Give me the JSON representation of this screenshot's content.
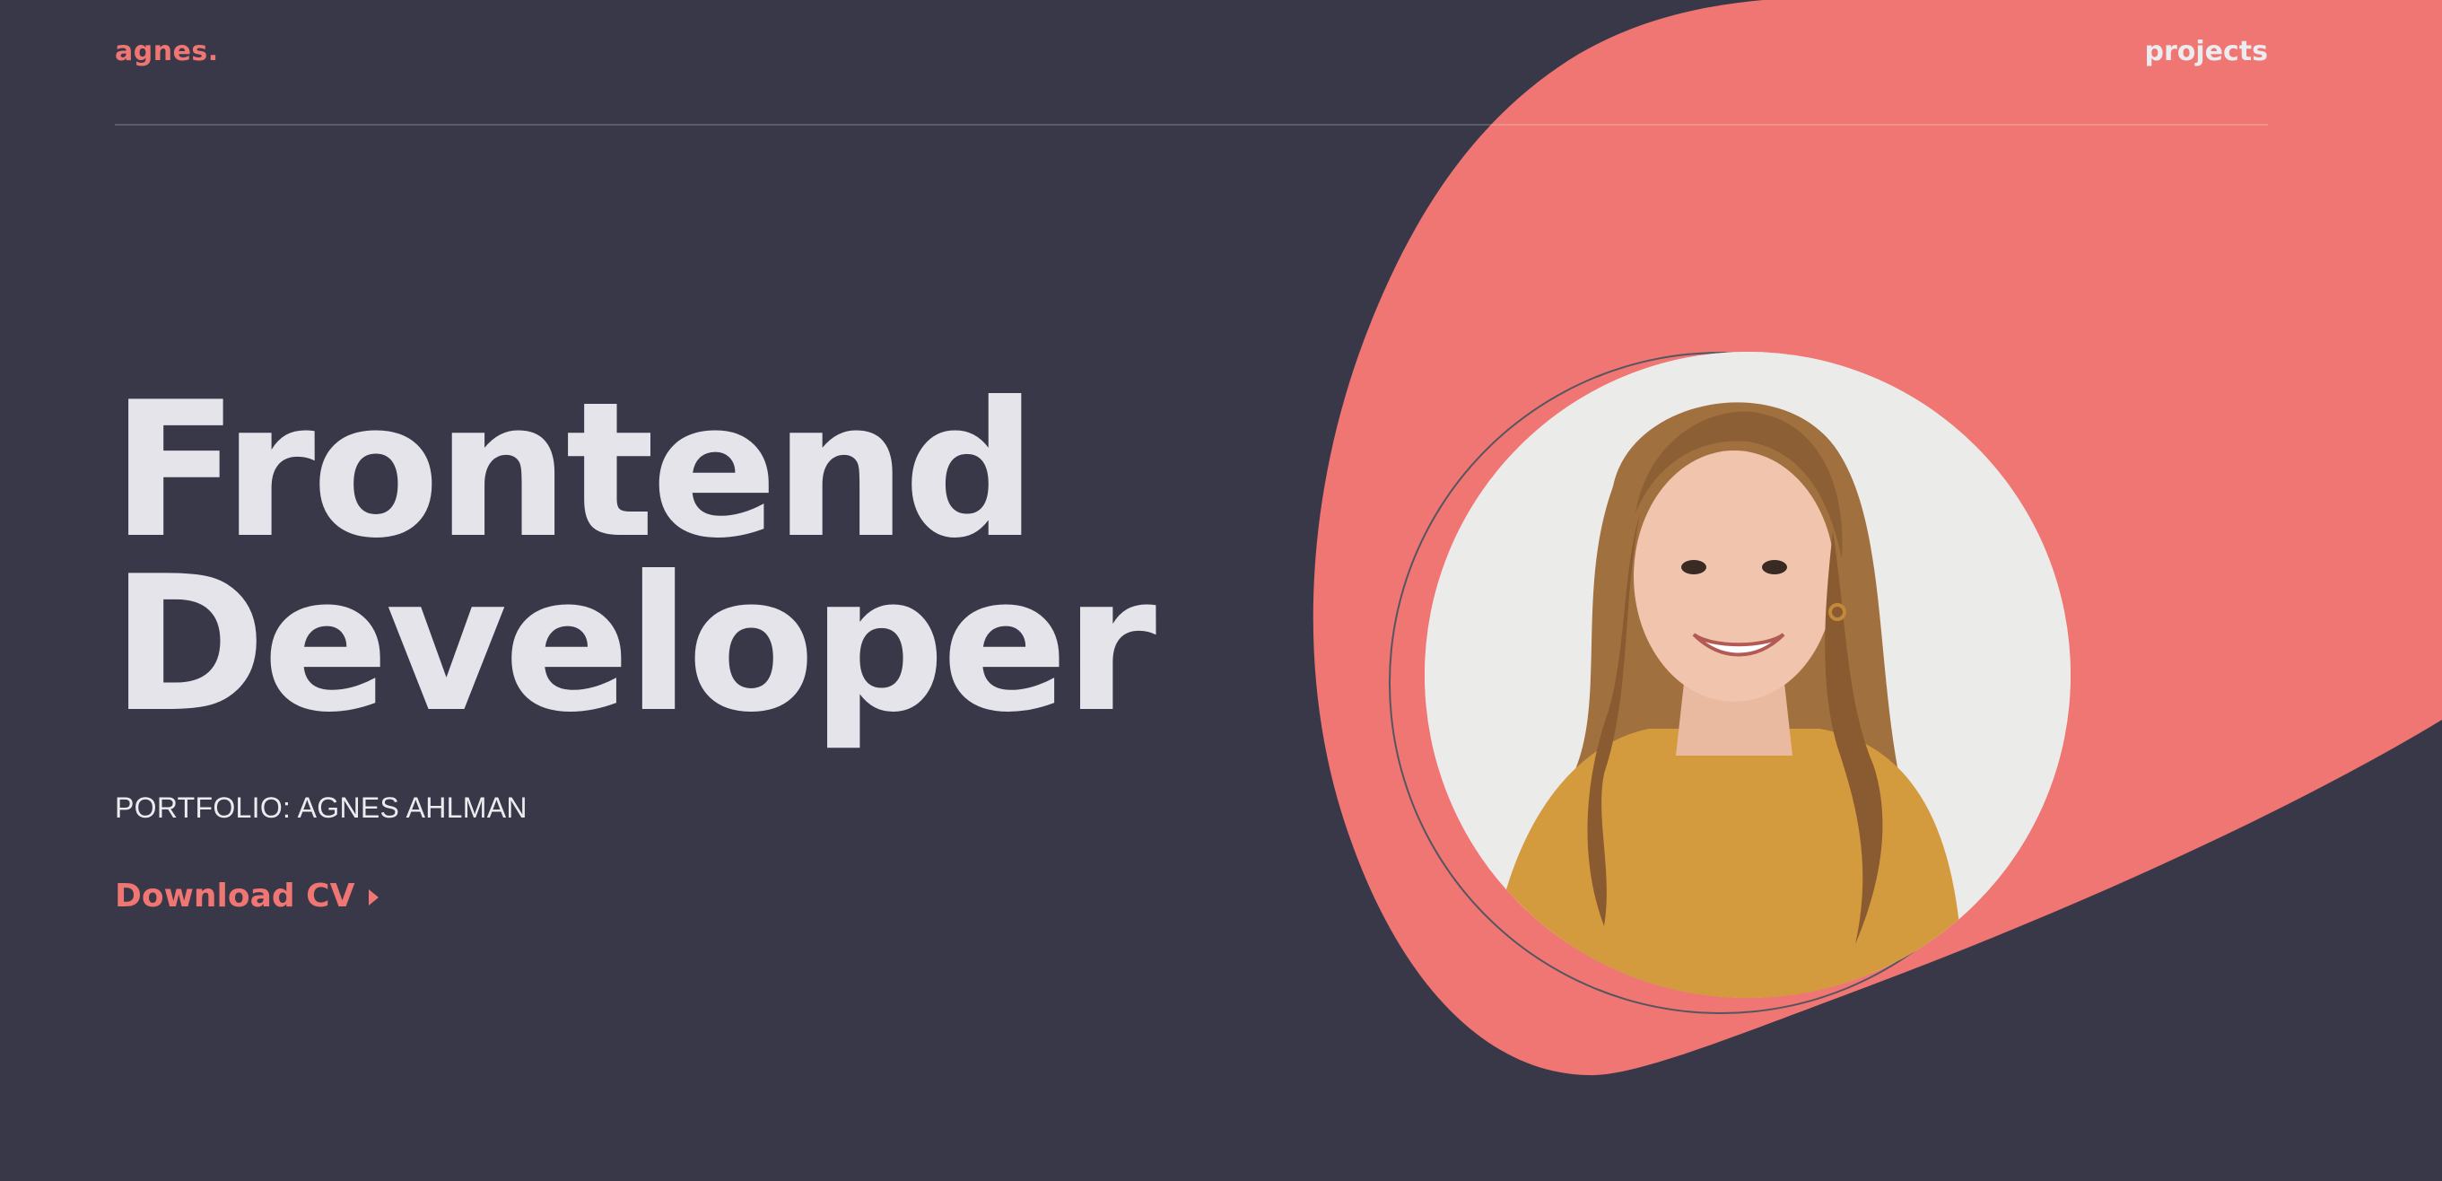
{
  "header": {
    "logo": "agnes.",
    "nav_projects": "projects"
  },
  "hero": {
    "title_line1": "Frontend",
    "title_line2": "Developer",
    "subtitle": "PORTFOLIO: AGNES AHLMAN",
    "cta_label": "Download CV"
  },
  "colors": {
    "background": "#383849",
    "accent": "#ef7672",
    "text_light": "#e4e4ea"
  },
  "icons": {
    "cta_icon": "caret-right-icon"
  }
}
